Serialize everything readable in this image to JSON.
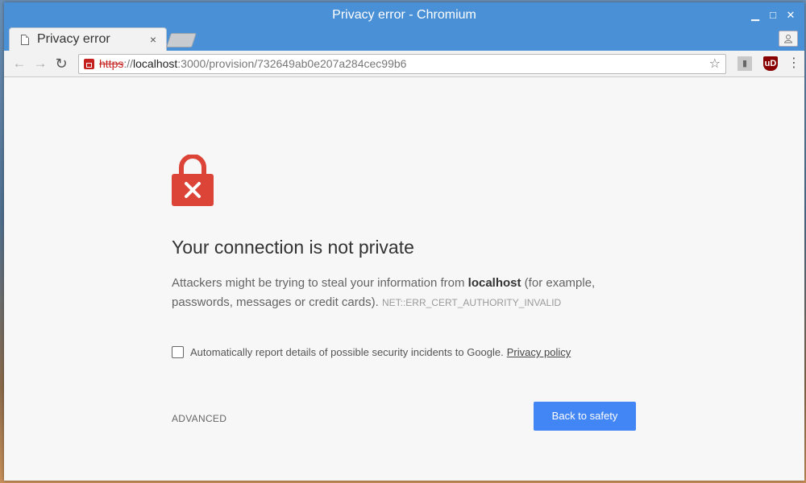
{
  "window": {
    "title": "Privacy error - Chromium",
    "minimize": "▁",
    "maximize": "□",
    "close": "✕"
  },
  "tab": {
    "title": "Privacy error",
    "close": "×"
  },
  "toolbar": {
    "back": "←",
    "forward": "→",
    "reload": "↻",
    "url_scheme": "https",
    "url_sep": "://",
    "url_host": "localhost",
    "url_rest": ":3000/provision/732649ab0e207a284cec99b6",
    "star": "☆",
    "ext1": "▮",
    "ext2": "uD",
    "menu": "⋮"
  },
  "interstitial": {
    "heading": "Your connection is not private",
    "desc_pre": "Attackers might be trying to steal your information from ",
    "desc_host": "localhost",
    "desc_post": " (for example, passwords, messages or credit cards). ",
    "error_code": "NET::ERR_CERT_AUTHORITY_INVALID",
    "report_text": "Automatically report details of possible security incidents to Google.",
    "privacy_link": "Privacy policy",
    "advanced_label": "ADVANCED",
    "safety_label": "Back to safety"
  },
  "colors": {
    "titlebar": "#4a90d6",
    "error_red": "#db4437",
    "button_blue": "#4285f4"
  }
}
